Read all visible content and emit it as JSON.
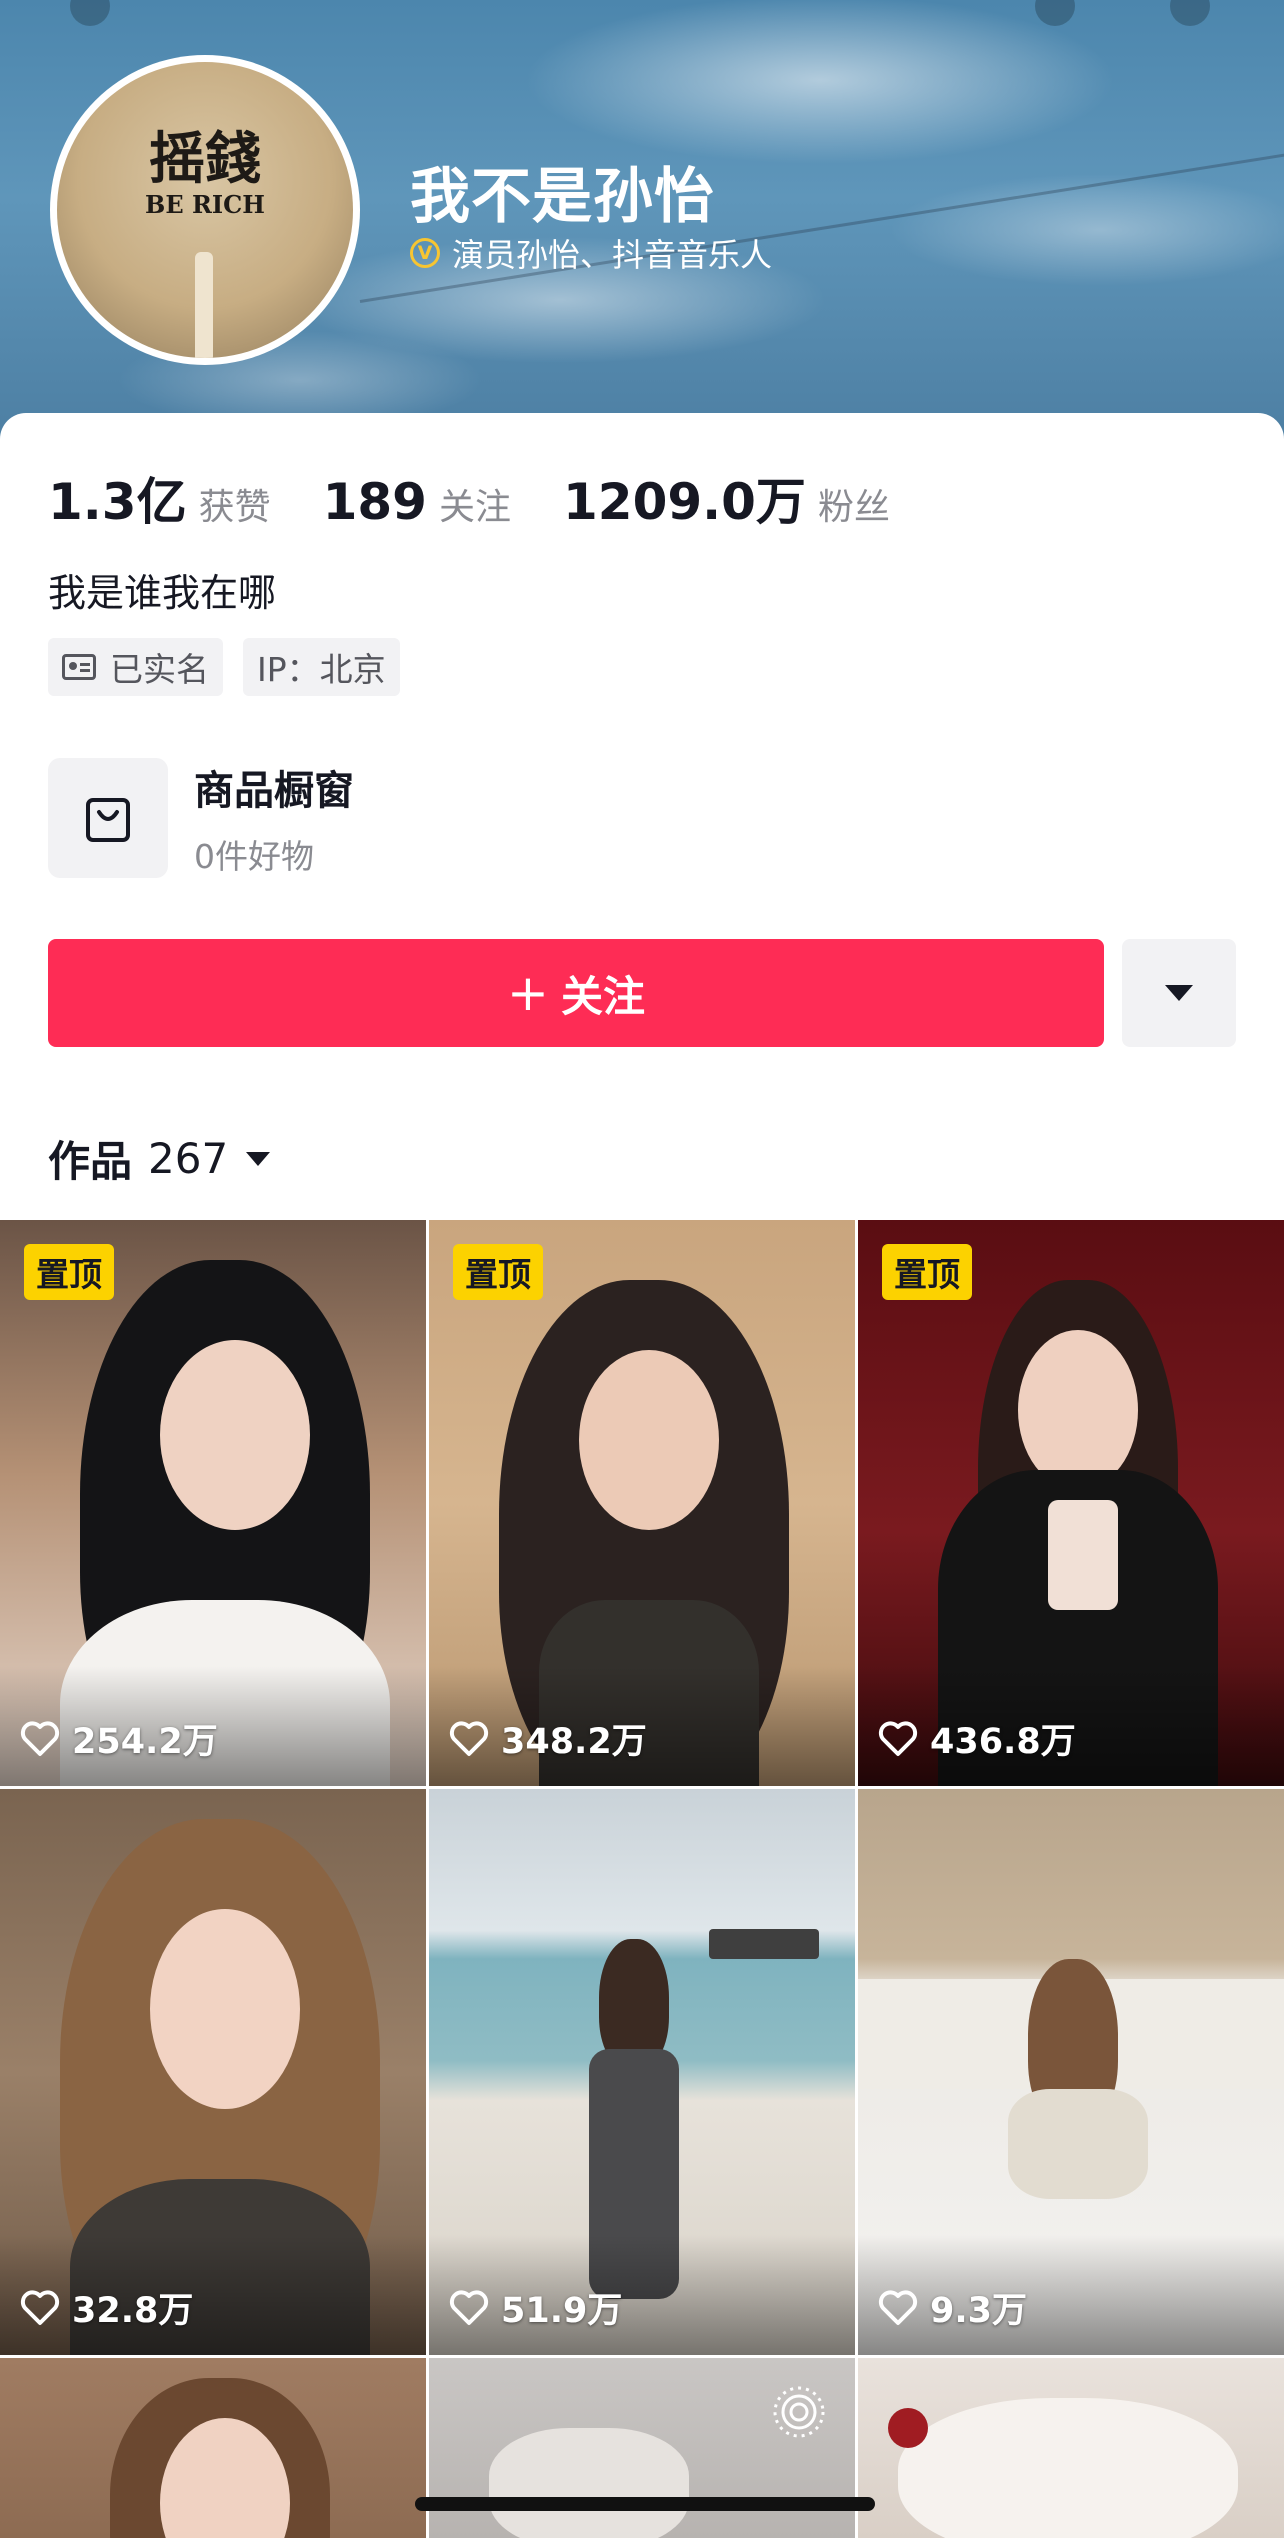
{
  "profile": {
    "name": "我不是孙怡",
    "verify_badge": "V",
    "verify_text": "演员孙怡、抖音音乐人",
    "avatar_fan_text_top": "摇錢",
    "avatar_fan_text_bottom": "BE RICH"
  },
  "stats": [
    {
      "value": "1.3亿",
      "label": "获赞"
    },
    {
      "value": "189",
      "label": "关注"
    },
    {
      "value": "1209.0万",
      "label": "粉丝"
    }
  ],
  "bio": "我是谁我在哪",
  "tags": {
    "realname": "已实名",
    "ip": "IP：北京"
  },
  "shop": {
    "title": "商品橱窗",
    "subtitle": "0件好物",
    "icon": "shopping-bag-icon"
  },
  "follow_button": {
    "plus": "+",
    "label": "关注"
  },
  "works": {
    "title": "作品",
    "count": "267"
  },
  "pinned_label": "置顶",
  "videos": [
    {
      "likes": "254.2万",
      "pinned": true
    },
    {
      "likes": "348.2万",
      "pinned": true
    },
    {
      "likes": "436.8万",
      "pinned": true
    },
    {
      "likes": "32.8万",
      "pinned": false
    },
    {
      "likes": "51.9万",
      "pinned": false
    },
    {
      "likes": "9.3万",
      "pinned": false
    }
  ],
  "colors": {
    "accent": "#fe2c55",
    "pin": "#fcd200",
    "verify": "#f7c531",
    "secondary_text": "#8a8b91"
  }
}
